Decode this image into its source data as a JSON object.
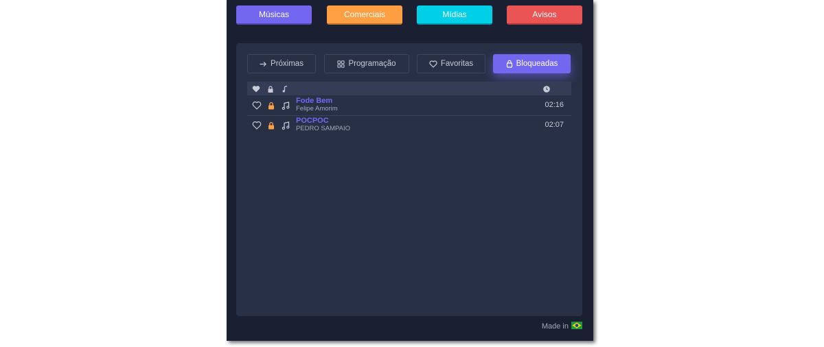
{
  "top_buttons": [
    {
      "label": "Músicas",
      "color": "#7367f0"
    },
    {
      "label": "Comerciais",
      "color": "#ff9f43"
    },
    {
      "label": "Mídias",
      "color": "#00cfe8"
    },
    {
      "label": "Avisos",
      "color": "#ea5455"
    }
  ],
  "tabs": [
    {
      "label": "Próximas",
      "icon": "arrow-right-icon"
    },
    {
      "label": "Programação",
      "icon": "grid-icon"
    },
    {
      "label": "Favoritas",
      "icon": "heart-icon"
    },
    {
      "label": "Bloqueadas",
      "icon": "lock-icon",
      "active": true
    }
  ],
  "table": {
    "header_icons": [
      "heart-icon",
      "lock-icon",
      "music-note-icon",
      "clock-icon"
    ],
    "rows": [
      {
        "title": "Fode Bem",
        "artist": "Felipe Amorim",
        "duration": "02:16",
        "favorite": false,
        "locked": true
      },
      {
        "title": "POCPOC",
        "artist": "PEDRO SAMPAIO",
        "duration": "02:07",
        "favorite": false,
        "locked": true
      }
    ]
  },
  "footer": {
    "label": "Made in",
    "flag": "brazil-flag-icon"
  },
  "colors": {
    "panel_bg": "#1a2032",
    "card_bg": "#283046",
    "accent": "#7367f0",
    "lock": "#ff9f43"
  }
}
